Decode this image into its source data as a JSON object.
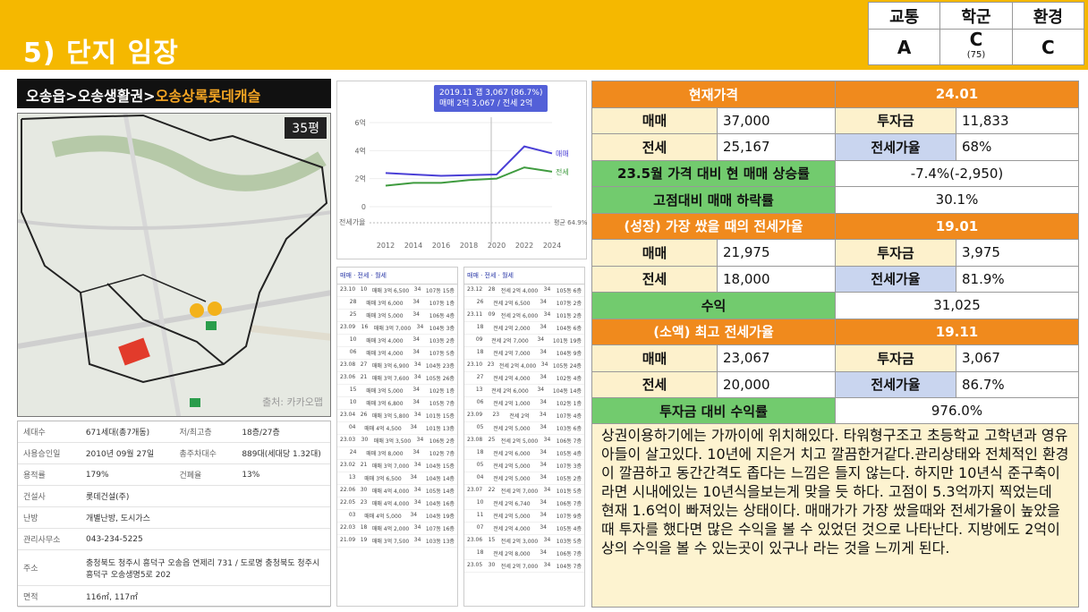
{
  "header": {
    "title": "5) 단지 임장"
  },
  "grades": {
    "headers": [
      "교통",
      "학군",
      "환경"
    ],
    "values": [
      "A",
      "C",
      "C"
    ],
    "school_sub": "(75)"
  },
  "breadcrumb": {
    "part1": "오송읍>오송생활권>",
    "part2": "오송상록롯데캐슬"
  },
  "map": {
    "size_badge": "35평",
    "watermark": "출처: 카카오맵"
  },
  "complex_info": [
    {
      "k": "세대수",
      "v": "671세대(총7개동)",
      "k2": "저/최고층",
      "v2": "18층/27층"
    },
    {
      "k": "사용승인일",
      "v": "2010년 09월 27일",
      "k2": "총주차대수",
      "v2": "889대(세대당 1.32대)"
    },
    {
      "k": "용적률",
      "v": "179%",
      "k2": "건폐율",
      "v2": "13%"
    },
    {
      "k": "건설사",
      "v": "롯데건설(주)",
      "k2": "",
      "v2": ""
    },
    {
      "k": "난방",
      "v": "개별난방, 도시가스",
      "k2": "",
      "v2": ""
    },
    {
      "k": "관리사무소",
      "v": "043-234-5225",
      "k2": "",
      "v2": ""
    },
    {
      "k": "주소",
      "v": "충청북도 청주시 흥덕구 오송읍 연제리 731 / 도로명 충청북도 청주시 흥덕구 오송생명5로 202",
      "k2": "",
      "v2": ""
    },
    {
      "k": "면적",
      "v": "116㎡, 117㎡",
      "k2": "",
      "v2": ""
    }
  ],
  "price_chart_tooltip": {
    "line1": "2019.11  갭 3,067 (86.7%)",
    "line2": "매매 2억 3,067 / 전세 2억"
  },
  "chart_data": {
    "type": "line",
    "x": [
      "2012",
      "2014",
      "2016",
      "2018",
      "2020",
      "2022",
      "2024"
    ],
    "y_ticks": [
      "6억",
      "4억",
      "2억",
      "0"
    ],
    "series": [
      {
        "name": "매매",
        "color": "#4a3fd6",
        "values": [
          2.4,
          2.3,
          2.2,
          2.25,
          2.3,
          4.3,
          3.8
        ]
      },
      {
        "name": "전세",
        "color": "#3f9b3f",
        "values": [
          1.5,
          1.7,
          1.7,
          1.9,
          2.0,
          2.8,
          2.5
        ]
      }
    ],
    "ratio_label": "전세가율",
    "ratio_value": "평균 64.9%"
  },
  "trade_lists": {
    "left": {
      "tabs": "매매 · 전세 · 월세",
      "rows": [
        [
          "23.10",
          "10",
          "매매 3억 6,500",
          "34",
          "107동 15층"
        ],
        [
          "",
          "28",
          "매매 3억 6,000",
          "34",
          "107동 1층"
        ],
        [
          "",
          "25",
          "매매 3억 5,000",
          "34",
          "106동 4층"
        ],
        [
          "23.09",
          "16",
          "매매 3억 7,000",
          "34",
          "104동 3층"
        ],
        [
          "",
          "10",
          "매매 3억 4,000",
          "34",
          "103동 2층"
        ],
        [
          "",
          "06",
          "매매 3억 4,000",
          "34",
          "107동 5층"
        ],
        [
          "23.08",
          "27",
          "매매 3억 6,900",
          "34",
          "104동 23층"
        ],
        [
          "23.06",
          "21",
          "매매 3억 7,600",
          "34",
          "105동 26층"
        ],
        [
          "",
          "15",
          "매매 3억 5,000",
          "34",
          "102동 1층"
        ],
        [
          "",
          "10",
          "매매 3억 6,800",
          "34",
          "105동 7층"
        ],
        [
          "23.04",
          "26",
          "매매 3억 5,800",
          "34",
          "101동 15층"
        ],
        [
          "",
          "04",
          "매매 4억 4,500",
          "34",
          "101동 13층"
        ],
        [
          "23.03",
          "30",
          "매매 3억 3,500",
          "34",
          "106동 2층"
        ],
        [
          "",
          "24",
          "매매 3억 8,000",
          "34",
          "102동 7층"
        ],
        [
          "23.02",
          "21",
          "매매 3억 7,000",
          "34",
          "104동 15층"
        ],
        [
          "",
          "13",
          "매매 3억 6,500",
          "34",
          "104동 14층"
        ],
        [
          "22.06",
          "30",
          "매매 4억 4,000",
          "34",
          "105동 14층"
        ],
        [
          "22.05",
          "23",
          "매매 4억 4,000",
          "34",
          "104동 16층"
        ],
        [
          "",
          "03",
          "매매 4억 5,000",
          "34",
          "104동 19층"
        ],
        [
          "22.03",
          "18",
          "매매 4억 2,000",
          "34",
          "107동 16층"
        ],
        [
          "21.09",
          "19",
          "매매 3억 7,500",
          "34",
          "103동 13층"
        ]
      ]
    },
    "right": {
      "tabs": "매매 · 전세 · 월세",
      "rows": [
        [
          "23.12",
          "28",
          "전세 2억 4,000",
          "34",
          "105동 6층"
        ],
        [
          "",
          "26",
          "전세 2억 6,500",
          "34",
          "107동 2층"
        ],
        [
          "23.11",
          "09",
          "전세 2억 6,000",
          "34",
          "101동 2층"
        ],
        [
          "",
          "18",
          "전세 2억 2,000",
          "34",
          "104동 6층"
        ],
        [
          "",
          "09",
          "전세 2억 7,000",
          "34",
          "101동 19층"
        ],
        [
          "",
          "18",
          "전세 2억 7,000",
          "34",
          "104동 9층"
        ],
        [
          "23.10",
          "23",
          "전세 2억 4,000",
          "34",
          "105동 24층"
        ],
        [
          "",
          "27",
          "전세 2억 4,000",
          "34",
          "102동 4층"
        ],
        [
          "",
          "13",
          "전세 2억 6,000",
          "34",
          "104동 14층"
        ],
        [
          "",
          "06",
          "전세 2억 1,000",
          "34",
          "102동 1층"
        ],
        [
          "23.09",
          "23",
          "전세 2억",
          "34",
          "107동 4층"
        ],
        [
          "",
          "05",
          "전세 2억 5,000",
          "34",
          "103동 6층"
        ],
        [
          "23.08",
          "25",
          "전세 2억 5,000",
          "34",
          "106동 7층"
        ],
        [
          "",
          "18",
          "전세 2억 6,000",
          "34",
          "105동 4층"
        ],
        [
          "",
          "05",
          "전세 2억 5,000",
          "34",
          "107동 3층"
        ],
        [
          "",
          "04",
          "전세 2억 5,000",
          "34",
          "105동 2층"
        ],
        [
          "23.07",
          "22",
          "전세 2억 7,000",
          "34",
          "101동 5층"
        ],
        [
          "",
          "10",
          "전세 2억 6,740",
          "34",
          "106동 7층"
        ],
        [
          "",
          "11",
          "전세 2억 5,000",
          "34",
          "107동 9층"
        ],
        [
          "",
          "07",
          "전세 2억 4,000",
          "34",
          "105동 4층"
        ],
        [
          "23.06",
          "15",
          "전세 2억 3,000",
          "34",
          "103동 5층"
        ],
        [
          "",
          "18",
          "전세 2억 8,000",
          "34",
          "106동 7층"
        ],
        [
          "23.05",
          "30",
          "전세 2억 7,000",
          "34",
          "104동 7층"
        ]
      ]
    }
  },
  "calc": {
    "current_label": "현재가격",
    "current_date": "24.01",
    "sale_label": "매매",
    "sale": "37,000",
    "invest_label": "투자금",
    "invest": "11,833",
    "jeonse_label": "전세",
    "jeonse": "25,167",
    "ratio_label": "전세가율",
    "ratio": "68%",
    "rise_label": "23.5월 가격 대비 현 매매 상승률",
    "rise": "-7.4%(-2,950)",
    "drop_label": "고점대비 매매 하락률",
    "drop": "30.1%",
    "growth_label": "(성장) 가장 쌌을 때의 전세가율",
    "growth_date": "19.01",
    "g_sale": "21,975",
    "g_invest": "3,975",
    "g_jeonse": "18,000",
    "g_ratio": "81.9%",
    "profit_label": "수익",
    "profit": "31,025",
    "peak_label": "(소액) 최고 전세가율",
    "peak_date": "19.11",
    "p_sale": "23,067",
    "p_invest": "3,067",
    "p_jeonse": "20,000",
    "p_ratio": "86.7%",
    "roi_label": "투자금 대비 수익률",
    "roi": "976.0%"
  },
  "note": "상권이용하기에는 가까이에 위치해있다. 타워형구조고 초등학교 고학년과 영유아들이 살고있다. 10년에 지은거 치고 깔끔한거같다.관리상태와 전체적인 환경이 깔끔하고 동간간격도 좁다는 느낌은 들지 않는다. 하지만 10년식 준구축이라면 시내에있는 10년식을보는게 맞을 듯 하다. 고점이 5.3억까지 찍었는데 현재 1.6억이 빠져있는 상태이다. 매매가가 가장 쌌을때와 전세가율이 높았을때 투자를 했다면 많은 수익을 볼 수 있었던 것으로 나타난다. 지방에도 2억이상의 수익을 볼 수 있는곳이 있구나 라는 것을 느끼게 된다."
}
